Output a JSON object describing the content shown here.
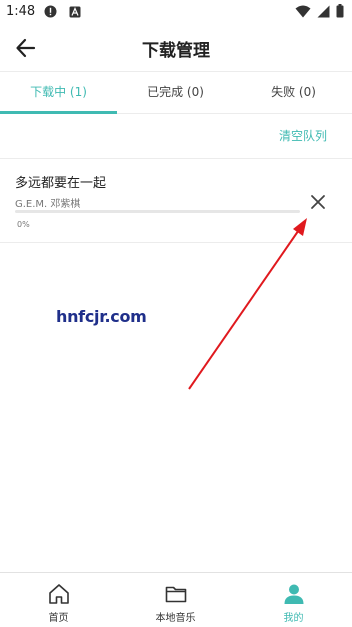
{
  "status_bar": {
    "time": "1:48",
    "left_icons": [
      "alert-circle-icon",
      "font-download-icon"
    ],
    "right_icons": [
      "wifi-icon",
      "cell-signal-icon",
      "battery-icon"
    ]
  },
  "header": {
    "title": "下载管理",
    "back_icon": "arrow-left-icon"
  },
  "tabs": [
    {
      "label": "下载中 (1)",
      "active": true
    },
    {
      "label": "已完成 (0)",
      "active": false
    },
    {
      "label": "失败 (0)",
      "active": false
    }
  ],
  "queue": {
    "clear_label": "清空队列"
  },
  "downloads": [
    {
      "title": "多远都要在一起",
      "artist": "G.E.M. 邓紫棋",
      "progress": 0,
      "progress_text": "0%"
    }
  ],
  "watermark": {
    "text": "hnfcjr.com"
  },
  "bottom_nav": [
    {
      "label": "首页",
      "icon": "home-icon",
      "active": false
    },
    {
      "label": "本地音乐",
      "icon": "folder-icon",
      "active": false
    },
    {
      "label": "我的",
      "icon": "person-icon",
      "active": true
    }
  ],
  "colors": {
    "accent": "#3fbab2",
    "annotation_arrow": "#e0191e",
    "watermark": "#1f2f8a"
  }
}
